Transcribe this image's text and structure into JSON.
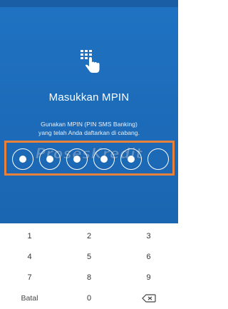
{
  "header": {
    "title": "Masukkan MPIN",
    "description_line1": "Gunakan MPIN (PIN SMS Banking)",
    "description_line2": "yang telah Anda daftarkan di cabang.",
    "icon": "keypad-tap-icon"
  },
  "watermark": {
    "text": "ProsesKredit"
  },
  "pin": {
    "length": 6,
    "entered": 5,
    "dots": [
      {
        "filled": true
      },
      {
        "filled": true
      },
      {
        "filled": true
      },
      {
        "filled": true
      },
      {
        "filled": true
      },
      {
        "filled": false
      }
    ]
  },
  "keypad": {
    "keys": [
      {
        "label": "1",
        "name": "key-1"
      },
      {
        "label": "2",
        "name": "key-2"
      },
      {
        "label": "3",
        "name": "key-3"
      },
      {
        "label": "4",
        "name": "key-4"
      },
      {
        "label": "5",
        "name": "key-5"
      },
      {
        "label": "6",
        "name": "key-6"
      },
      {
        "label": "7",
        "name": "key-7"
      },
      {
        "label": "8",
        "name": "key-8"
      },
      {
        "label": "9",
        "name": "key-9"
      },
      {
        "label": "Batal",
        "name": "cancel-button"
      },
      {
        "label": "0",
        "name": "key-0"
      },
      {
        "label": "",
        "name": "backspace-button",
        "icon": "backspace-icon"
      }
    ]
  },
  "colors": {
    "header_bg": "#1f73c2",
    "highlight_border": "#e8813a",
    "keypad_text": "#333333"
  }
}
